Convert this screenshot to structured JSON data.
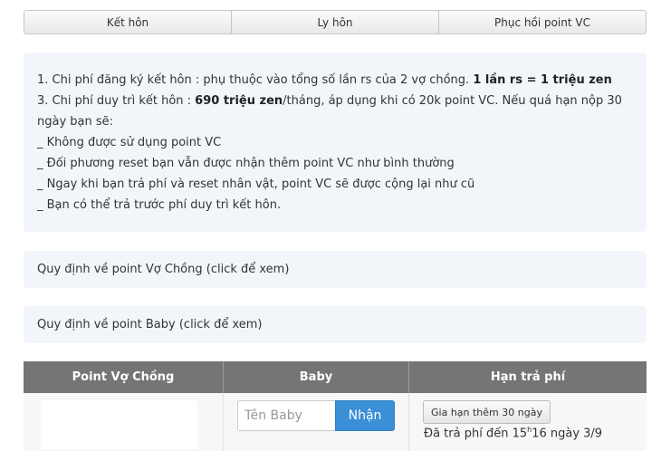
{
  "tabs": [
    {
      "label": "Kết hôn"
    },
    {
      "label": "Ly hôn"
    },
    {
      "label": "Phục hồi point VC"
    }
  ],
  "info": {
    "line1_prefix": "1. Chi phí đăng ký kết hôn : phụ thuộc vào tổng số lần rs của 2 vợ chồng. ",
    "line1_bold": "1 lần rs = 1 triệu zen",
    "line2_prefix": "3. Chi phí duy trì kết hôn : ",
    "line2_bold": "690 triệu zen",
    "line2_suffix": "/tháng, áp dụng khi có 20k point VC. Nếu quá hạn nộp 30 ngày bạn sẽ:",
    "bullets": [
      "_ Không được sử dụng point VC",
      "_ Đối phương reset bạn vẫn được nhận thêm point VC như bình thường",
      "_ Ngay khi bạn trả phí và reset nhân vật, point VC sẽ được cộng lại như cũ",
      "_ Bạn có thể trả trước phí duy trì kết hôn."
    ]
  },
  "panels": {
    "point_vc": "Quy định về point Vợ Chồng (click để xem)",
    "point_baby": "Quy định về point Baby (click để xem)"
  },
  "table": {
    "headers": [
      "Point Vợ Chồng",
      "Baby",
      "Hạn trả phí"
    ],
    "baby_placeholder": "Tên Baby",
    "baby_button": "Nhận",
    "extend_button": "Gia hạn thêm 30 ngày",
    "paid_prefix": "Đã trả phí đến 15",
    "paid_sup": "h",
    "paid_suffix": "16 ngày 3/9"
  },
  "colors": {
    "header_bg": "#757575",
    "panel_bg": "#f2f6fb",
    "accent": "#3a8fd6"
  }
}
